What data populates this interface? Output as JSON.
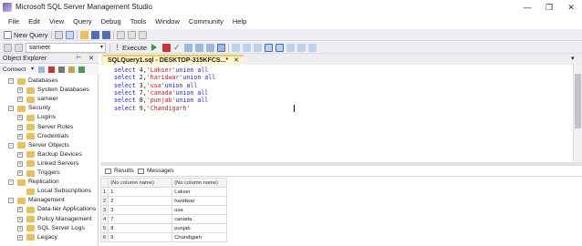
{
  "window": {
    "title": "Microsoft SQL Server Management Studio",
    "controls": {
      "minimize": "—",
      "restore": "❐",
      "close": "✕"
    }
  },
  "menu": [
    "File",
    "Edit",
    "View",
    "Query",
    "Debug",
    "Tools",
    "Window",
    "Community",
    "Help"
  ],
  "toolbar": {
    "new_query": "New Query",
    "database": "sameer",
    "execute": "Execute"
  },
  "object_explorer": {
    "title": "Object Explorer",
    "connect": "Connect",
    "tree": [
      {
        "label": "Databases",
        "level": 0,
        "expander": "−"
      },
      {
        "label": "System Databases",
        "level": 1,
        "expander": "+"
      },
      {
        "label": "sameer",
        "level": 1,
        "expander": "+"
      },
      {
        "label": "Security",
        "level": 0,
        "expander": "−"
      },
      {
        "label": "Logins",
        "level": 1,
        "expander": "+"
      },
      {
        "label": "Server Roles",
        "level": 1,
        "expander": "+"
      },
      {
        "label": "Credentials",
        "level": 1,
        "expander": "+"
      },
      {
        "label": "Server Objects",
        "level": 0,
        "expander": "−"
      },
      {
        "label": "Backup Devices",
        "level": 1,
        "expander": "+"
      },
      {
        "label": "Linked Servers",
        "level": 1,
        "expander": "+"
      },
      {
        "label": "Triggers",
        "level": 1,
        "expander": "+"
      },
      {
        "label": "Replication",
        "level": 0,
        "expander": "−"
      },
      {
        "label": "Local Subscriptions",
        "level": 1,
        "expander": ""
      },
      {
        "label": "Management",
        "level": 0,
        "expander": "−"
      },
      {
        "label": "Data-tier Applications",
        "level": 1,
        "expander": "+"
      },
      {
        "label": "Policy Management",
        "level": 1,
        "expander": "+"
      },
      {
        "label": "SQL Server Logs",
        "level": 1,
        "expander": "+"
      },
      {
        "label": "Legacy",
        "level": 1,
        "expander": "+"
      }
    ]
  },
  "editor": {
    "tab_title": "SQLQuery1.sql - DESKTOP-315KFCS...*",
    "lines": [
      {
        "num": "4",
        "text": "'Lakser'",
        "suffix": "union all"
      },
      {
        "num": "2",
        "text": "'haridwar'",
        "suffix": "union all"
      },
      {
        "num": "3",
        "text": "'usa'",
        "suffix": "union all"
      },
      {
        "num": "7",
        "text": "'canada'",
        "suffix": "union all"
      },
      {
        "num": "8",
        "text": "'punjab'",
        "suffix": "union all"
      },
      {
        "num": "9",
        "text": "'Chandigarh'",
        "suffix": ""
      }
    ]
  },
  "results": {
    "tabs": [
      "Results",
      "Messages"
    ],
    "columns": [
      "(No column name)",
      "(No column name)"
    ],
    "rows": [
      [
        "1",
        "1",
        "Lakser"
      ],
      [
        "2",
        "2",
        "haridwar"
      ],
      [
        "3",
        "3",
        "usa"
      ],
      [
        "4",
        "7",
        "canada"
      ],
      [
        "5",
        "8",
        "punjab"
      ],
      [
        "6",
        "9",
        "Chandigarh"
      ]
    ]
  },
  "colors": {
    "accent_tab": "#fff8cc",
    "keyword": "#1a1aff",
    "string": "#d11919"
  }
}
